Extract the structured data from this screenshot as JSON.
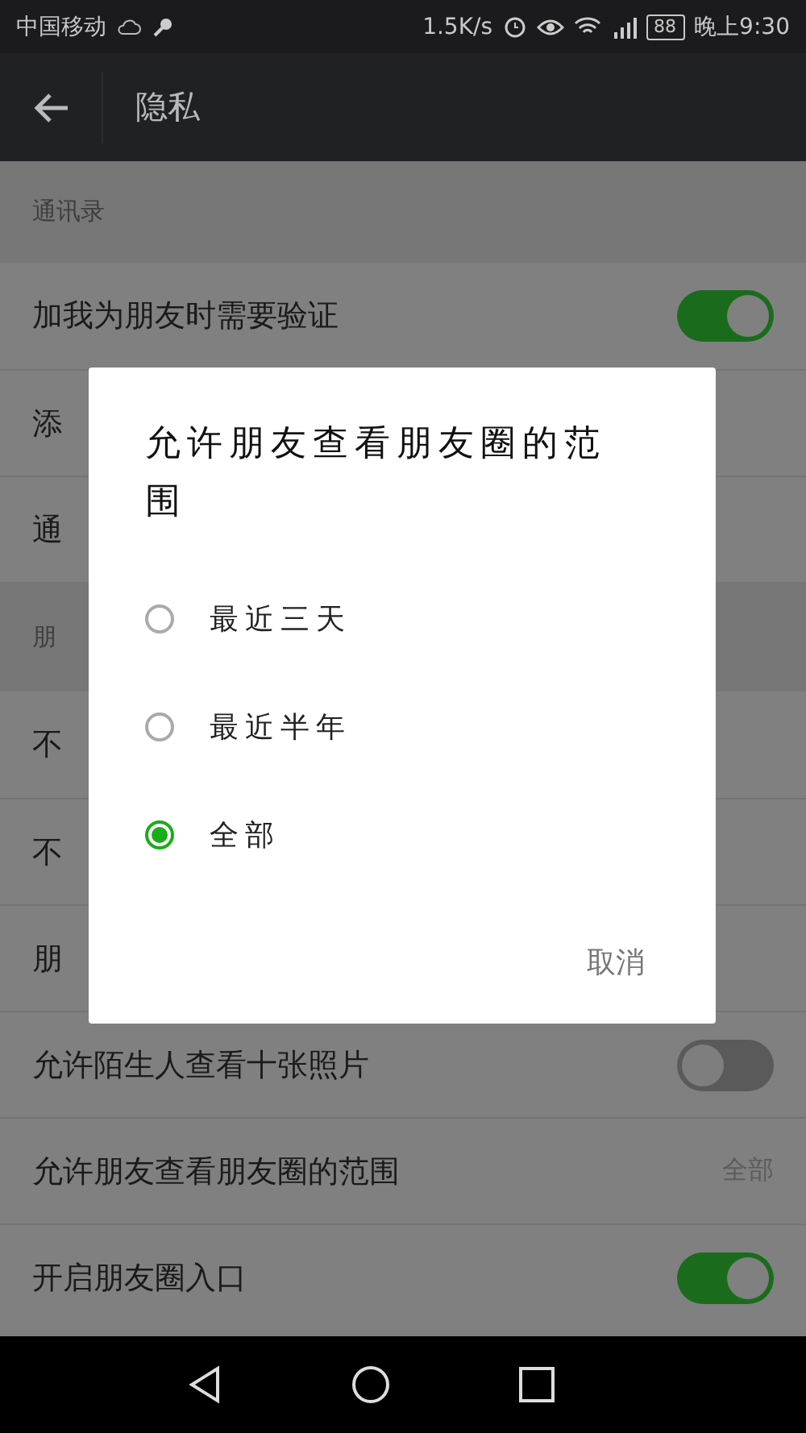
{
  "status_bar": {
    "carrier": "中国移动",
    "speed": "1.5K/s",
    "battery": "88",
    "time": "晚上9:30"
  },
  "toolbar": {
    "title": "隐私"
  },
  "sections": [
    {
      "header": "通讯录",
      "items": [
        {
          "kind": "toggle",
          "label": "加我为朋友时需要验证",
          "on": true
        },
        {
          "kind": "link",
          "label": "添"
        },
        {
          "kind": "link",
          "label": "通"
        }
      ]
    },
    {
      "header": "朋",
      "items": [
        {
          "kind": "link",
          "label": "不"
        },
        {
          "kind": "link",
          "label": "不"
        },
        {
          "kind": "link",
          "label": "朋"
        },
        {
          "kind": "toggle",
          "label": "允许陌生人查看十张照片",
          "on": false
        },
        {
          "kind": "value",
          "label": "允许朋友查看朋友圈的范围",
          "value": "全部"
        },
        {
          "kind": "toggle",
          "label": "开启朋友圈入口",
          "on": true
        }
      ]
    }
  ],
  "dialog": {
    "title": "允许朋友查看朋友圈的范围",
    "options": [
      {
        "label": "最近三天",
        "selected": false
      },
      {
        "label": "最近半年",
        "selected": false
      },
      {
        "label": "全部",
        "selected": true
      }
    ],
    "cancel": "取消"
  }
}
